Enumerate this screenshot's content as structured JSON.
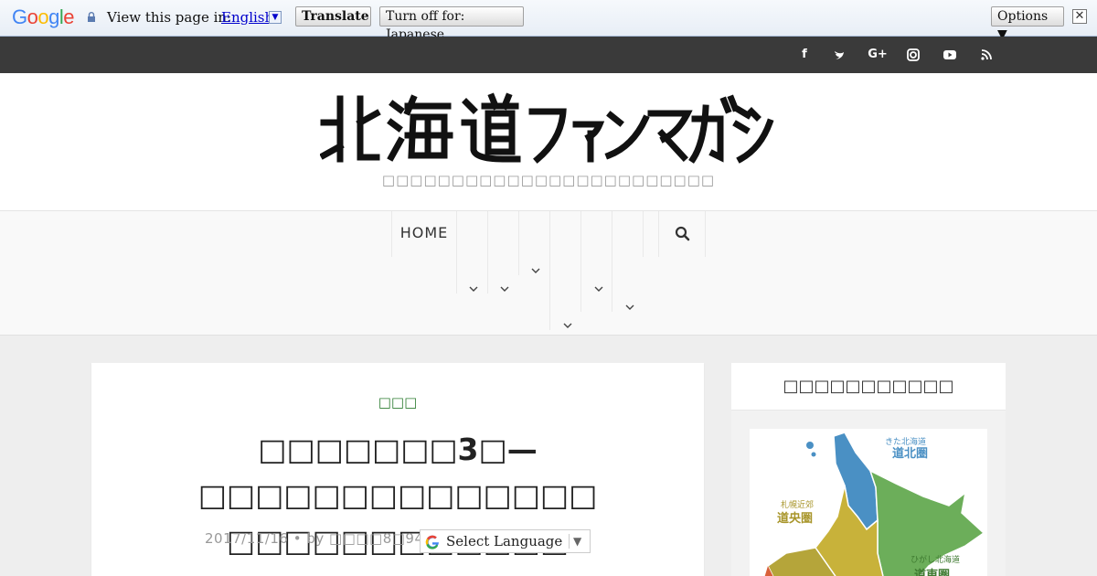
{
  "translate_bar": {
    "logo": "Google",
    "view_text": "View this page in:",
    "language": "English",
    "translate_button": "Translate",
    "turn_off_button": "Turn off for: Japanese",
    "options_button": "Options ▼",
    "close": "✕"
  },
  "social": {
    "facebook": "f",
    "twitter": "t",
    "googleplus": "G+",
    "instagram": "◎",
    "youtube": "▶",
    "rss": "≈"
  },
  "header": {
    "logo_alt": "北海道ファンマガジン",
    "tagline": "□□□□□□□□□□□□□□□□□□□□□□□□"
  },
  "nav": {
    "home": "HOME"
  },
  "article": {
    "category": "□□□",
    "title_line1": "□□□□□□□3□—□□□□□□□□□□□□□□",
    "title_line2": "□□□□□□□□□□□□",
    "meta": "2017/11/16 • by □□□□8□94 pt •",
    "select_language": "Select Language"
  },
  "sidebar": {
    "heading": "□□□□□□□□□□□",
    "map_labels": {
      "north_small": "きた北海道",
      "north": "道北圏",
      "central_small": "札幌近郊",
      "central": "道央圏",
      "east_small": "ひがし北海道",
      "east": "道東圏"
    }
  }
}
